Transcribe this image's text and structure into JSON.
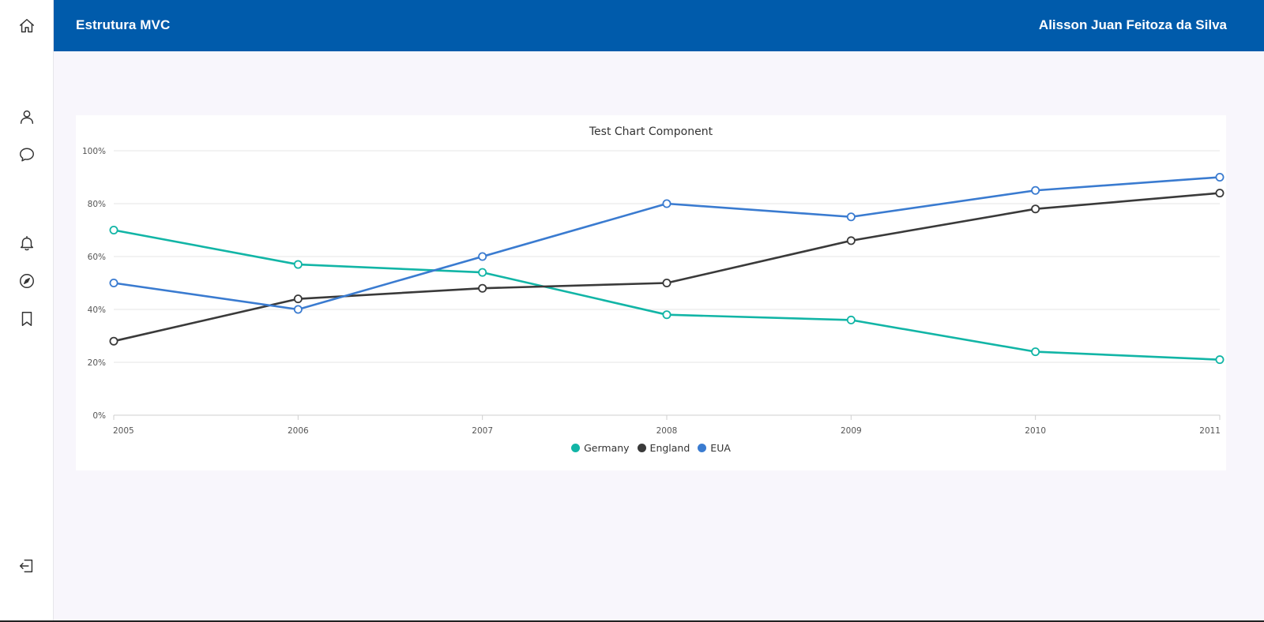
{
  "header": {
    "title": "Estrutura MVC",
    "user_name": "Alisson Juan Feitoza da Silva",
    "background": "#005bab"
  },
  "sidebar": {
    "icons": [
      "home-icon",
      "user-icon",
      "chat-icon",
      "bell-icon",
      "compass-icon",
      "bookmark-icon",
      "logout-icon"
    ]
  },
  "chart_data": {
    "type": "line",
    "title": "Test Chart Component",
    "x": [
      "2005",
      "2006",
      "2007",
      "2008",
      "2009",
      "2010",
      "2011"
    ],
    "y_ticks": [
      "0%",
      "20%",
      "40%",
      "60%",
      "80%",
      "100%"
    ],
    "ylim": [
      0,
      100
    ],
    "grid": true,
    "legend_position": "bottom-center",
    "series": [
      {
        "name": "Germany",
        "color": "#12b5a6",
        "values": [
          70,
          57,
          54,
          38,
          36,
          24,
          21
        ]
      },
      {
        "name": "England",
        "color": "#3a3a3a",
        "values": [
          28,
          44,
          48,
          50,
          66,
          78,
          84
        ]
      },
      {
        "name": "EUA",
        "color": "#3a7bd0",
        "values": [
          50,
          40,
          60,
          80,
          75,
          85,
          90
        ]
      }
    ]
  }
}
